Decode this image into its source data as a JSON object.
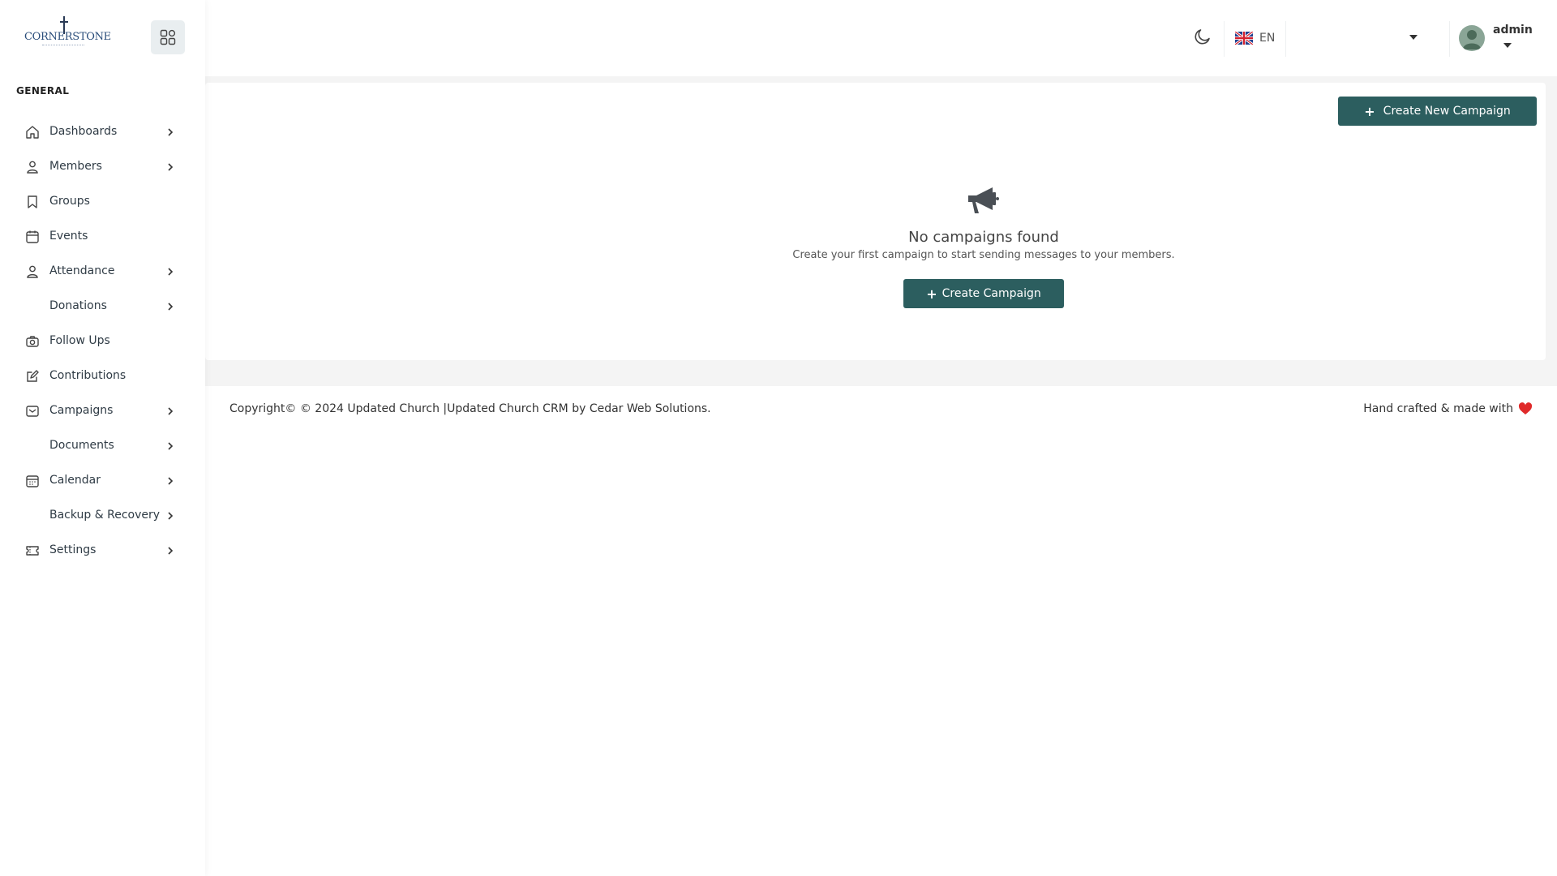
{
  "app": {
    "logo_text": "CORNERSTONE"
  },
  "sidebar": {
    "section_label": "GENERAL",
    "items": [
      {
        "label": "Dashboards",
        "icon": "home-icon",
        "has_chevron": true
      },
      {
        "label": "Members",
        "icon": "user-icon",
        "has_chevron": true
      },
      {
        "label": "Groups",
        "icon": "bookmark-icon",
        "has_chevron": false
      },
      {
        "label": "Events",
        "icon": "calendar-icon",
        "has_chevron": false
      },
      {
        "label": "Attendance",
        "icon": "user-icon",
        "has_chevron": true
      },
      {
        "label": "Donations",
        "icon": "",
        "has_chevron": true
      },
      {
        "label": "Follow Ups",
        "icon": "camera-icon",
        "has_chevron": false
      },
      {
        "label": "Contributions",
        "icon": "edit-icon",
        "has_chevron": false
      },
      {
        "label": "Campaigns",
        "icon": "mail-icon",
        "has_chevron": true
      },
      {
        "label": "Documents",
        "icon": "",
        "has_chevron": true
      },
      {
        "label": "Calendar",
        "icon": "calendar-icon",
        "has_chevron": true
      },
      {
        "label": "Backup & Recovery",
        "icon": "",
        "has_chevron": true
      },
      {
        "label": "Settings",
        "icon": "ticket-icon",
        "has_chevron": true
      }
    ]
  },
  "topbar": {
    "language_code": "EN",
    "user_name": "admin"
  },
  "main": {
    "create_new_label": "Create New Campaign",
    "empty_title": "No campaigns found",
    "empty_subtitle": "Create your first campaign to start sending messages to your members.",
    "create_label": "Create Campaign"
  },
  "footer": {
    "copyright": "Copyright© © 2024 Updated Church |Updated Church CRM by Cedar Web Solutions.",
    "crafted": "Hand crafted & made with"
  },
  "colors": {
    "primary": "#2c5e5f",
    "heart": "#e02a2a"
  }
}
